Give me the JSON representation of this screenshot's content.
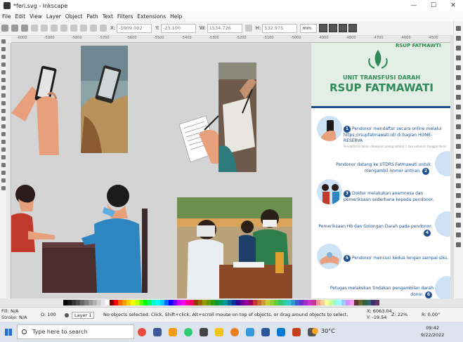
{
  "window": {
    "title": "*feri.svg - Inkscape",
    "minimize": "—",
    "maximize": "☐",
    "close": "✕"
  },
  "menu": [
    "File",
    "Edit",
    "View",
    "Layer",
    "Object",
    "Path",
    "Text",
    "Filters",
    "Extensions",
    "Help"
  ],
  "command_bar": {
    "x_label": "X:",
    "x_value": "-5909.002",
    "y_label": "Y:",
    "y_value": "-23.100",
    "w_label": "W:",
    "w_value": "1534.726",
    "h_label": "H:",
    "h_value": "532.975",
    "unit": "mm"
  },
  "ruler_ticks": [
    "-6000",
    "-5900",
    "-5800",
    "-5700",
    "-5600",
    "-5500",
    "-5400",
    "-5300",
    "-5200",
    "-5100",
    "-5000",
    "-4900",
    "-4800",
    "-4700",
    "-4600",
    "-4500"
  ],
  "poster": {
    "top_name": "RSUP FATMAWTI",
    "org_line1": "UNIT TRANSFUSI DARAH",
    "org_line2": "RSUP FATMAWATI",
    "steps": [
      {
        "num": "1",
        "text": "Pendonor mendaftar secara online melalui https://rsupfatmawati.id/ di bagian HOME-RESERVA",
        "note": "Pendaftaran donor dilakukan paling lambat 1 hari sebelum tanggal donor"
      },
      {
        "num": "2",
        "text": "Pendonor datang ke UTDRS Fatmawati untuk mengambil nomor antrian."
      },
      {
        "num": "3",
        "text": "Dokter melakukan anamnesa dan pemeriksaan sederhana kepada pendonor."
      },
      {
        "num": "4",
        "text": "Pemeriksaan Hb dan Golongan Darah pada pendonor."
      },
      {
        "num": "5",
        "text": "Pendonor mencuci kedua lengan sampai siku."
      },
      {
        "num": "6",
        "text": "Petugas melakukan tindakan pengambilan darah donor."
      }
    ]
  },
  "status": {
    "fill_label": "Fill:",
    "fill_value": "N/A",
    "stroke_label": "Stroke:",
    "stroke_value": "N/A",
    "opacity_label": "O:",
    "opacity_value": "100",
    "layer": "Layer 1",
    "message": "No objects selected. Click, Shift+click, Alt+scroll mouse on top of objects, or drag around objects to select.",
    "x_label": "X:",
    "x_value": "6063.04",
    "y_label": "Y:",
    "y_value": "-19.54",
    "zoom_label": "Z:",
    "zoom_value": "22%",
    "rot_label": "R:",
    "rot_value": "0.00°"
  },
  "taskbar": {
    "search_placeholder": "Type here to search",
    "weather": "30°C",
    "time": "09:42",
    "date": "9/22/2022"
  },
  "palette": [
    "#000000",
    "#1a1a1a",
    "#333333",
    "#4d4d4d",
    "#666666",
    "#808080",
    "#999999",
    "#b3b3b3",
    "#cccccc",
    "#e6e6e6",
    "#ffffff",
    "#800000",
    "#ff0000",
    "#ff6600",
    "#ff9900",
    "#ffcc00",
    "#ffff00",
    "#ccff00",
    "#66ff00",
    "#00ff00",
    "#00ff66",
    "#00ffcc",
    "#00ffff",
    "#00ccff",
    "#0066ff",
    "#0000ff",
    "#6600ff",
    "#cc00ff",
    "#ff00ff",
    "#ff0099",
    "#ff0066",
    "#993300",
    "#996600",
    "#999900",
    "#669900",
    "#339900",
    "#009933",
    "#009966",
    "#009999",
    "#006699",
    "#003399",
    "#330099",
    "#660099",
    "#990099",
    "#990066",
    "#cc3333",
    "#cc6633",
    "#cc9933",
    "#cccc33",
    "#99cc33",
    "#66cc33",
    "#33cc66",
    "#33cc99",
    "#33cccc",
    "#3399cc",
    "#3366cc",
    "#6633cc",
    "#9933cc",
    "#cc33cc",
    "#cc3399",
    "#ff9999",
    "#ffcc99",
    "#ffff99",
    "#ccff99",
    "#99ffcc",
    "#99ffff",
    "#99ccff",
    "#cc99ff",
    "#ff99ff",
    "#663333",
    "#666633",
    "#336633",
    "#336666",
    "#333366",
    "#663366"
  ]
}
